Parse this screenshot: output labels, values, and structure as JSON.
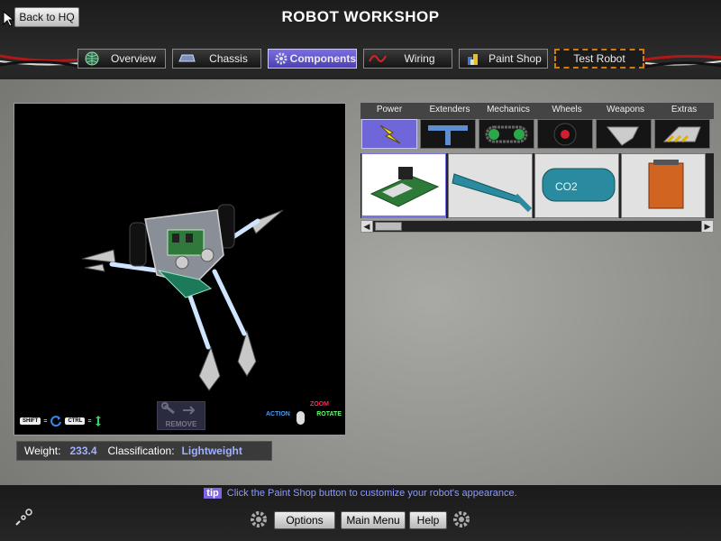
{
  "header": {
    "back_label": "Back to HQ",
    "title": "ROBOT WORKSHOP"
  },
  "nav_tabs": [
    {
      "label": "Overview",
      "icon": "globe-icon"
    },
    {
      "label": "Chassis",
      "icon": "chassis-icon"
    },
    {
      "label": "Components",
      "icon": "gear-icon",
      "active": true
    },
    {
      "label": "Wiring",
      "icon": "wire-icon"
    },
    {
      "label": "Paint Shop",
      "icon": "paint-cans-icon"
    },
    {
      "label": "Test Robot",
      "icon": ""
    }
  ],
  "viewer": {
    "shift_key": "SHIFT",
    "ctrl_key": "CTRL",
    "remove_label": "REMOVE",
    "zoom_label": "ZOOM",
    "action_label": "ACTION",
    "rotate_label": "ROTATE"
  },
  "stats": {
    "weight_label": "Weight:",
    "weight_value": "233.4",
    "class_label": "Classification:",
    "class_value": "Lightweight"
  },
  "categories": [
    {
      "label": "Power",
      "icon": "lightning-icon",
      "active": true
    },
    {
      "label": "Extenders",
      "icon": "t-bar-icon"
    },
    {
      "label": "Mechanics",
      "icon": "chain-icon"
    },
    {
      "label": "Wheels",
      "icon": "wheel-icon"
    },
    {
      "label": "Weapons",
      "icon": "blade-icon"
    },
    {
      "label": "Extras",
      "icon": "plow-icon"
    }
  ],
  "parts": [
    {
      "name": "circuit-board-part",
      "text": "",
      "selected": true
    },
    {
      "name": "blue-tank-part",
      "text": ""
    },
    {
      "name": "co2-tank-part",
      "text": "CO2"
    },
    {
      "name": "battery-box-part",
      "text": ""
    }
  ],
  "footer": {
    "tip_tag": "tip",
    "tip_text": "Click the Paint Shop button to customize your robot's appearance.",
    "options_label": "Options",
    "main_menu_label": "Main Menu",
    "help_label": "Help"
  },
  "colors": {
    "accent": "#6e66d9",
    "link_text": "#9fb1ff",
    "test_border": "#d07a10"
  }
}
